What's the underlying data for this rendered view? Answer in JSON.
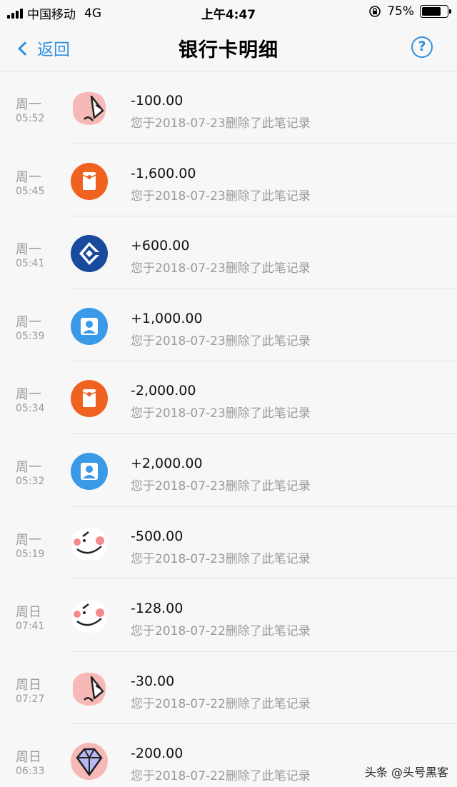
{
  "status_bar": {
    "carrier": "中国移动",
    "network": "4G",
    "time": "上午4:47",
    "battery_text": "75%",
    "battery_level": 0.75
  },
  "nav": {
    "back_label": "返回",
    "title": "银行卡明细",
    "help_glyph": "?"
  },
  "transactions": [
    {
      "day": "周一",
      "time": "05:52",
      "amount": "-100.00",
      "desc": "您于2018-07-23删除了此笔记录",
      "icon": "sticker-pink-icon"
    },
    {
      "day": "周一",
      "time": "05:45",
      "amount": "-1,600.00",
      "desc": "您于2018-07-23删除了此笔记录",
      "icon": "red-packet-icon"
    },
    {
      "day": "周一",
      "time": "05:41",
      "amount": "+600.00",
      "desc": "您于2018-07-23删除了此笔记录",
      "icon": "ccb-bank-icon"
    },
    {
      "day": "周一",
      "time": "05:39",
      "amount": "+1,000.00",
      "desc": "您于2018-07-23删除了此笔记录",
      "icon": "user-avatar-icon"
    },
    {
      "day": "周一",
      "time": "05:34",
      "amount": "-2,000.00",
      "desc": "您于2018-07-23删除了此笔记录",
      "icon": "red-packet-icon"
    },
    {
      "day": "周一",
      "time": "05:32",
      "amount": "+2,000.00",
      "desc": "您于2018-07-23删除了此笔记录",
      "icon": "user-avatar-icon"
    },
    {
      "day": "周一",
      "time": "05:19",
      "amount": "-500.00",
      "desc": "您于2018-07-23删除了此笔记录",
      "icon": "sticker-face-icon"
    },
    {
      "day": "周日",
      "time": "07:41",
      "amount": "-128.00",
      "desc": "您于2018-07-22删除了此笔记录",
      "icon": "sticker-face-icon"
    },
    {
      "day": "周日",
      "time": "07:27",
      "amount": "-30.00",
      "desc": "您于2018-07-22删除了此笔记录",
      "icon": "sticker-pink-icon"
    },
    {
      "day": "周日",
      "time": "06:33",
      "amount": "-200.00",
      "desc": "您于2018-07-22删除了此笔记录",
      "icon": "sticker-diamond-icon"
    }
  ],
  "watermark": "头条 @头号黑客",
  "colors": {
    "accent_blue": "#2f8fdd",
    "red_packet": "#f0621f",
    "ccb_blue": "#1a4a9e",
    "avatar_blue": "#3a9ae8",
    "sticker_pink": "#f7b9b7"
  }
}
